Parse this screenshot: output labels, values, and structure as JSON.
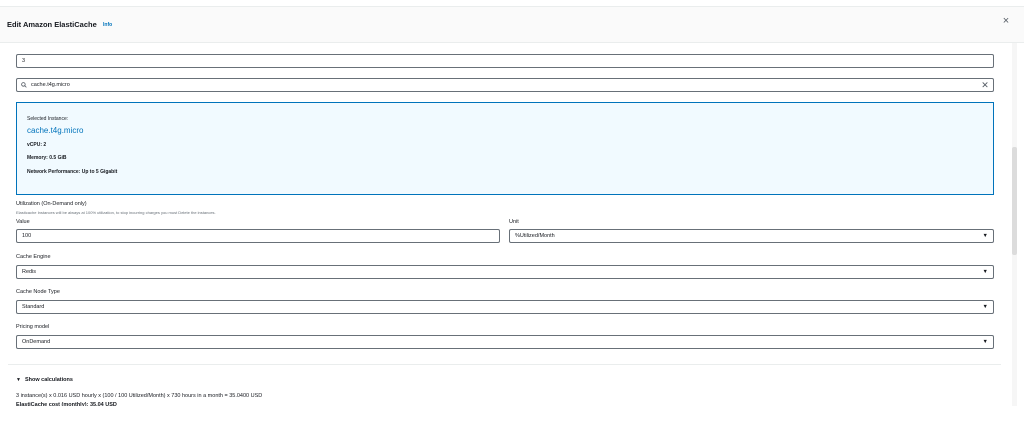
{
  "modal": {
    "title": "Edit Amazon ElastiCache",
    "info_label": "Info",
    "close_label": "×"
  },
  "quantity": {
    "value": "3"
  },
  "instance_search": {
    "value": "cache.t4g.micro",
    "clear_label": "✕"
  },
  "selected_instance": {
    "label": "Selected Instance:",
    "name": "cache.t4g.micro",
    "vcpu": "vCPU: 2",
    "memory": "Memory: 0.5 GiB",
    "network": "Network Performance: Up to 5 Gigabit"
  },
  "utilization": {
    "label": "Utilization (On-Demand only)",
    "description": "Elasticache Instances will be always at 100% utilization, to stop incurring charges you must Delete the instances.",
    "value_label": "Value",
    "value": "100",
    "unit_label": "Unit",
    "unit": "%Utilized/Month"
  },
  "cache_engine": {
    "label": "Cache Engine",
    "value": "Redis"
  },
  "cache_node_type": {
    "label": "Cache Node Type",
    "value": "Standard"
  },
  "pricing_model": {
    "label": "Pricing model",
    "value": "OnDemand"
  },
  "calculations": {
    "toggle_label": "Show calculations",
    "formula": "3 instance(s) x 0.016 USD hourly x (100 / 100 Utilized/Month) x 730 hours in a month = 35.0400 USD",
    "total": "ElastiCache cost (monthly): 35.04 USD"
  },
  "icons": {
    "search": "search-icon",
    "caret": "caret-down-icon",
    "close": "close-icon"
  },
  "colors": {
    "accent": "#0073bb",
    "info_box_bg": "#f1faff",
    "border": "#687078"
  }
}
